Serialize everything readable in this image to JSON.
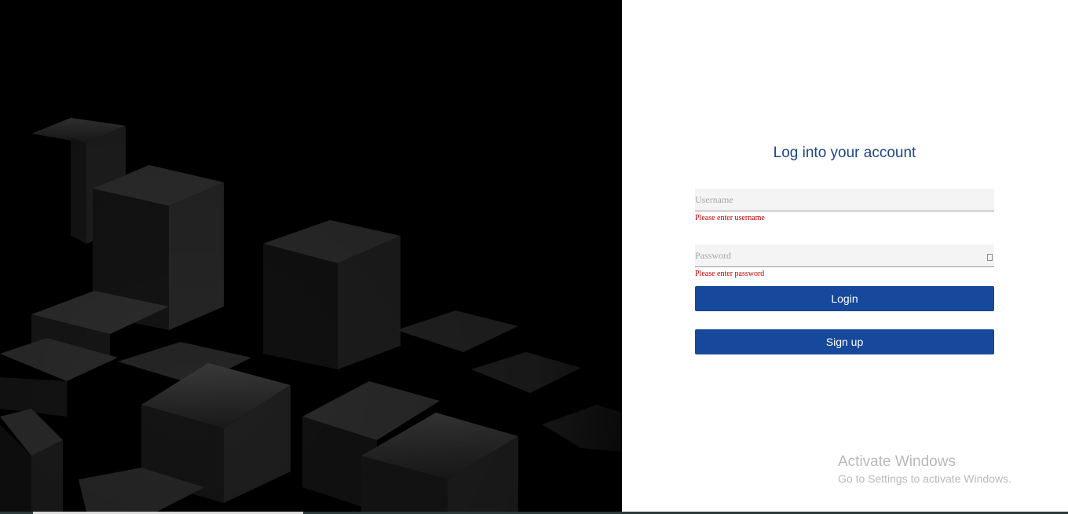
{
  "login": {
    "title": "Log into your account",
    "username": {
      "placeholder": "Username",
      "value": "",
      "error": "Please enter username"
    },
    "password": {
      "placeholder": "Password",
      "value": "",
      "error": "Please enter password",
      "toggle_icon": "show-password-icon"
    },
    "login_label": "Login",
    "signup_label": "Sign up"
  },
  "background": {
    "description_icon": "dark-cubes-background"
  },
  "watermark": {
    "title": "Activate Windows",
    "subtitle": "Go to Settings to activate Windows."
  },
  "colors": {
    "title": "#1d4489",
    "button": "#16489b",
    "error": "#c00000",
    "field_bg": "#f4f4f4"
  }
}
